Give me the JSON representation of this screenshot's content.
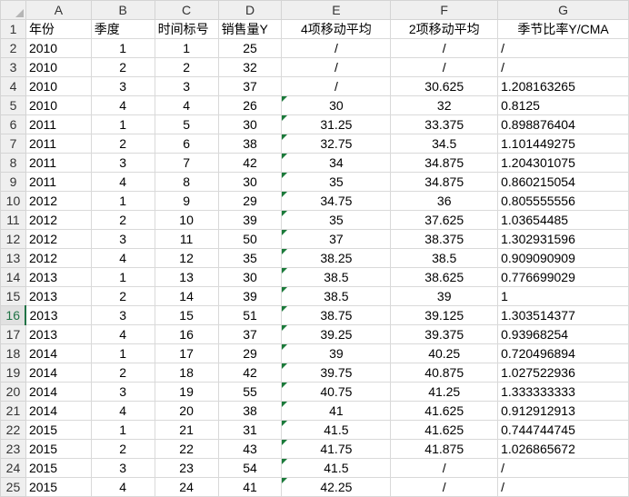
{
  "columns": [
    "A",
    "B",
    "C",
    "D",
    "E",
    "F",
    "G"
  ],
  "headers": [
    "年份",
    "季度",
    "时间标号",
    "销售量Y",
    "4项移动平均",
    "2项移动平均",
    "季节比率Y/CMA"
  ],
  "rows": [
    [
      "2010",
      "1",
      "1",
      "25",
      "/",
      "/",
      "/"
    ],
    [
      "2010",
      "2",
      "2",
      "32",
      "/",
      "/",
      "/"
    ],
    [
      "2010",
      "3",
      "3",
      "37",
      "/",
      "30.625",
      "1.208163265"
    ],
    [
      "2010",
      "4",
      "4",
      "26",
      "30",
      "32",
      "0.8125"
    ],
    [
      "2011",
      "1",
      "5",
      "30",
      "31.25",
      "33.375",
      "0.898876404"
    ],
    [
      "2011",
      "2",
      "6",
      "38",
      "32.75",
      "34.5",
      "1.101449275"
    ],
    [
      "2011",
      "3",
      "7",
      "42",
      "34",
      "34.875",
      "1.204301075"
    ],
    [
      "2011",
      "4",
      "8",
      "30",
      "35",
      "34.875",
      "0.860215054"
    ],
    [
      "2012",
      "1",
      "9",
      "29",
      "34.75",
      "36",
      "0.805555556"
    ],
    [
      "2012",
      "2",
      "10",
      "39",
      "35",
      "37.625",
      "1.03654485"
    ],
    [
      "2012",
      "3",
      "11",
      "50",
      "37",
      "38.375",
      "1.302931596"
    ],
    [
      "2012",
      "4",
      "12",
      "35",
      "38.25",
      "38.5",
      "0.909090909"
    ],
    [
      "2013",
      "1",
      "13",
      "30",
      "38.5",
      "38.625",
      "0.776699029"
    ],
    [
      "2013",
      "2",
      "14",
      "39",
      "38.5",
      "39",
      "1"
    ],
    [
      "2013",
      "3",
      "15",
      "51",
      "38.75",
      "39.125",
      "1.303514377"
    ],
    [
      "2013",
      "4",
      "16",
      "37",
      "39.25",
      "39.375",
      "0.93968254"
    ],
    [
      "2014",
      "1",
      "17",
      "29",
      "39",
      "40.25",
      "0.720496894"
    ],
    [
      "2014",
      "2",
      "18",
      "42",
      "39.75",
      "40.875",
      "1.027522936"
    ],
    [
      "2014",
      "3",
      "19",
      "55",
      "40.75",
      "41.25",
      "1.333333333"
    ],
    [
      "2014",
      "4",
      "20",
      "38",
      "41",
      "41.625",
      "0.912912913"
    ],
    [
      "2015",
      "1",
      "21",
      "31",
      "41.5",
      "41.625",
      "0.744744745"
    ],
    [
      "2015",
      "2",
      "22",
      "43",
      "41.75",
      "41.875",
      "1.026865672"
    ],
    [
      "2015",
      "3",
      "23",
      "54",
      "41.5",
      "/",
      "/"
    ],
    [
      "2015",
      "4",
      "24",
      "41",
      "42.25",
      "/",
      "/"
    ]
  ],
  "row_numbers": [
    "1",
    "2",
    "3",
    "4",
    "5",
    "6",
    "7",
    "8",
    "9",
    "10",
    "11",
    "12",
    "13",
    "14",
    "15",
    "16",
    "17",
    "18",
    "19",
    "20",
    "21",
    "22",
    "23",
    "24",
    "25"
  ],
  "active_row": "16",
  "colors": {
    "header_bg": "#efefef",
    "grid": "#d9d9d9",
    "flag": "#1b7a3a",
    "active": "#217346"
  }
}
